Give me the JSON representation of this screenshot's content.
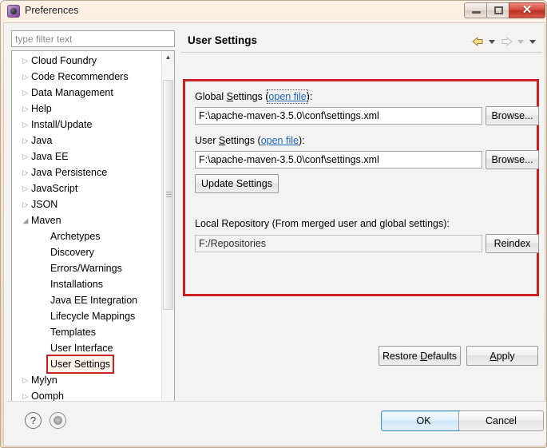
{
  "window": {
    "title": "Preferences",
    "icon": "eclipse-app-icon",
    "controls": {
      "minimize": "minimize-icon",
      "maximize": "maximize-icon",
      "close": "✕"
    }
  },
  "sidebar": {
    "filter": {
      "placeholder": "type filter text",
      "value": ""
    },
    "items": [
      {
        "label": "Cloud Foundry",
        "expandable": true,
        "expanded": false,
        "child": false
      },
      {
        "label": "Code Recommenders",
        "expandable": true,
        "expanded": false,
        "child": false
      },
      {
        "label": "Data Management",
        "expandable": true,
        "expanded": false,
        "child": false
      },
      {
        "label": "Help",
        "expandable": true,
        "expanded": false,
        "child": false
      },
      {
        "label": "Install/Update",
        "expandable": true,
        "expanded": false,
        "child": false
      },
      {
        "label": "Java",
        "expandable": true,
        "expanded": false,
        "child": false
      },
      {
        "label": "Java EE",
        "expandable": true,
        "expanded": false,
        "child": false
      },
      {
        "label": "Java Persistence",
        "expandable": true,
        "expanded": false,
        "child": false
      },
      {
        "label": "JavaScript",
        "expandable": true,
        "expanded": false,
        "child": false
      },
      {
        "label": "JSON",
        "expandable": true,
        "expanded": false,
        "child": false
      },
      {
        "label": "Maven",
        "expandable": true,
        "expanded": true,
        "child": false
      },
      {
        "label": "Archetypes",
        "expandable": false,
        "expanded": false,
        "child": true
      },
      {
        "label": "Discovery",
        "expandable": false,
        "expanded": false,
        "child": true
      },
      {
        "label": "Errors/Warnings",
        "expandable": false,
        "expanded": false,
        "child": true
      },
      {
        "label": "Installations",
        "expandable": false,
        "expanded": false,
        "child": true
      },
      {
        "label": "Java EE Integration",
        "expandable": false,
        "expanded": false,
        "child": true
      },
      {
        "label": "Lifecycle Mappings",
        "expandable": false,
        "expanded": false,
        "child": true
      },
      {
        "label": "Templates",
        "expandable": false,
        "expanded": false,
        "child": true
      },
      {
        "label": "User Interface",
        "expandable": false,
        "expanded": false,
        "child": true
      },
      {
        "label": "User Settings",
        "expandable": false,
        "expanded": false,
        "child": true,
        "selected": true
      },
      {
        "label": "Mylyn",
        "expandable": true,
        "expanded": false,
        "child": false
      },
      {
        "label": "Oomph",
        "expandable": true,
        "expanded": false,
        "child": false
      }
    ],
    "scrollbar": {
      "up_arrow": "▲",
      "down_arrow": "▼"
    }
  },
  "panel": {
    "title": "User Settings",
    "nav": {
      "back_icon": "back-arrow-icon",
      "back_dropdown_icon": "chevron-down-icon",
      "forward_icon": "forward-arrow-icon",
      "forward_dropdown_icon": "chevron-down-icon",
      "menu_dropdown_icon": "chevron-down-icon"
    },
    "global_settings": {
      "label_before": "Global ",
      "label_mnemonic": "S",
      "label_after": "ettings (",
      "link": "open file",
      "label_end": "):",
      "value": "F:\\apache-maven-3.5.0\\conf\\settings.xml",
      "browse_label": "Browse..."
    },
    "user_settings": {
      "label_before": "User ",
      "label_mnemonic": "S",
      "label_after": "ettings (",
      "link": "open file",
      "label_end": "):",
      "value": "F:\\apache-maven-3.5.0\\conf\\settings.xml",
      "browse_label": "Browse..."
    },
    "update_settings_label": "Update Settings",
    "local_repository": {
      "label": "Local Repository (From merged user and global settings):",
      "value": "F:/Repositories",
      "reindex_label": "Reindex"
    },
    "restore_defaults": {
      "before": "Restore ",
      "mnemonic": "D",
      "after": "efaults"
    },
    "apply": {
      "before": "",
      "mnemonic": "A",
      "after": "pply"
    }
  },
  "bottom": {
    "help_icon": "?",
    "secondary_icon": "apply-and-close-icon",
    "ok_label": "OK",
    "cancel_label": "Cancel"
  },
  "colors": {
    "annotation": "#cc1f1f",
    "link": "#2063c4",
    "titlebar_close": "#d4483a",
    "default_button_border": "#4a95c4"
  }
}
